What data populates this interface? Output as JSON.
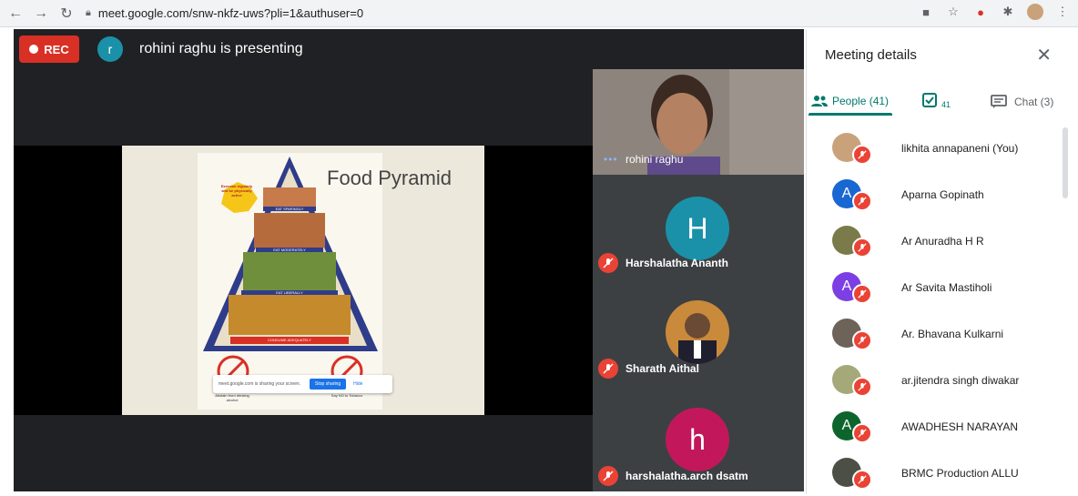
{
  "browser": {
    "url": "meet.google.com/snw-nkfz-uws?pli=1&authuser=0"
  },
  "meeting": {
    "rec_label": "REC",
    "presenter_initial": "r",
    "presenting_text": "rohini raghu is presenting"
  },
  "slide": {
    "title": "Food Pyramid",
    "badge_text": "Exercise regularly and be physically active",
    "tiers": [
      "EAT SPARINGLY",
      "EAT MODERATELY",
      "EAT LIBERALLY",
      "CONSUME ADEQUATELY"
    ],
    "captions": [
      "Abstain from drinking alcohol",
      "Say NO to Tobacco"
    ],
    "share_bar": {
      "text": "meet.google.com is sharing your screen.",
      "stop": "Stop sharing",
      "hide": "Hide"
    }
  },
  "tiles": [
    {
      "name": "rohini raghu",
      "type": "video"
    },
    {
      "name": "Harshalatha Ananth",
      "initial": "H",
      "color": "#1a91a8"
    },
    {
      "name": "Sharath Aithal",
      "type": "photo"
    },
    {
      "name": "harshalatha.arch dsatm",
      "initial": "h",
      "color": "#c2185b"
    }
  ],
  "panel": {
    "title": "Meeting details",
    "tabs": {
      "people": "People (41)",
      "activity": "41",
      "chat": "Chat (3)"
    },
    "people": [
      {
        "name": "likhita annapaneni (You)",
        "initial": "",
        "color": "#c9a27c"
      },
      {
        "name": "Aparna Gopinath",
        "initial": "A",
        "color": "#1967d2"
      },
      {
        "name": "Ar Anuradha H R",
        "initial": "",
        "color": "#7a7a4a"
      },
      {
        "name": "Ar Savita Mastiholi",
        "initial": "A",
        "color": "#7b3fe4"
      },
      {
        "name": "Ar. Bhavana Kulkarni",
        "initial": "",
        "color": "#6d6359"
      },
      {
        "name": "ar.jitendra singh diwakar",
        "initial": "",
        "color": "#a5a878"
      },
      {
        "name": "AWADHESH NARAYAN",
        "initial": "A",
        "color": "#0d652d"
      },
      {
        "name": "BRMC Production ALLU",
        "initial": "",
        "color": "#4b4f46"
      }
    ]
  }
}
